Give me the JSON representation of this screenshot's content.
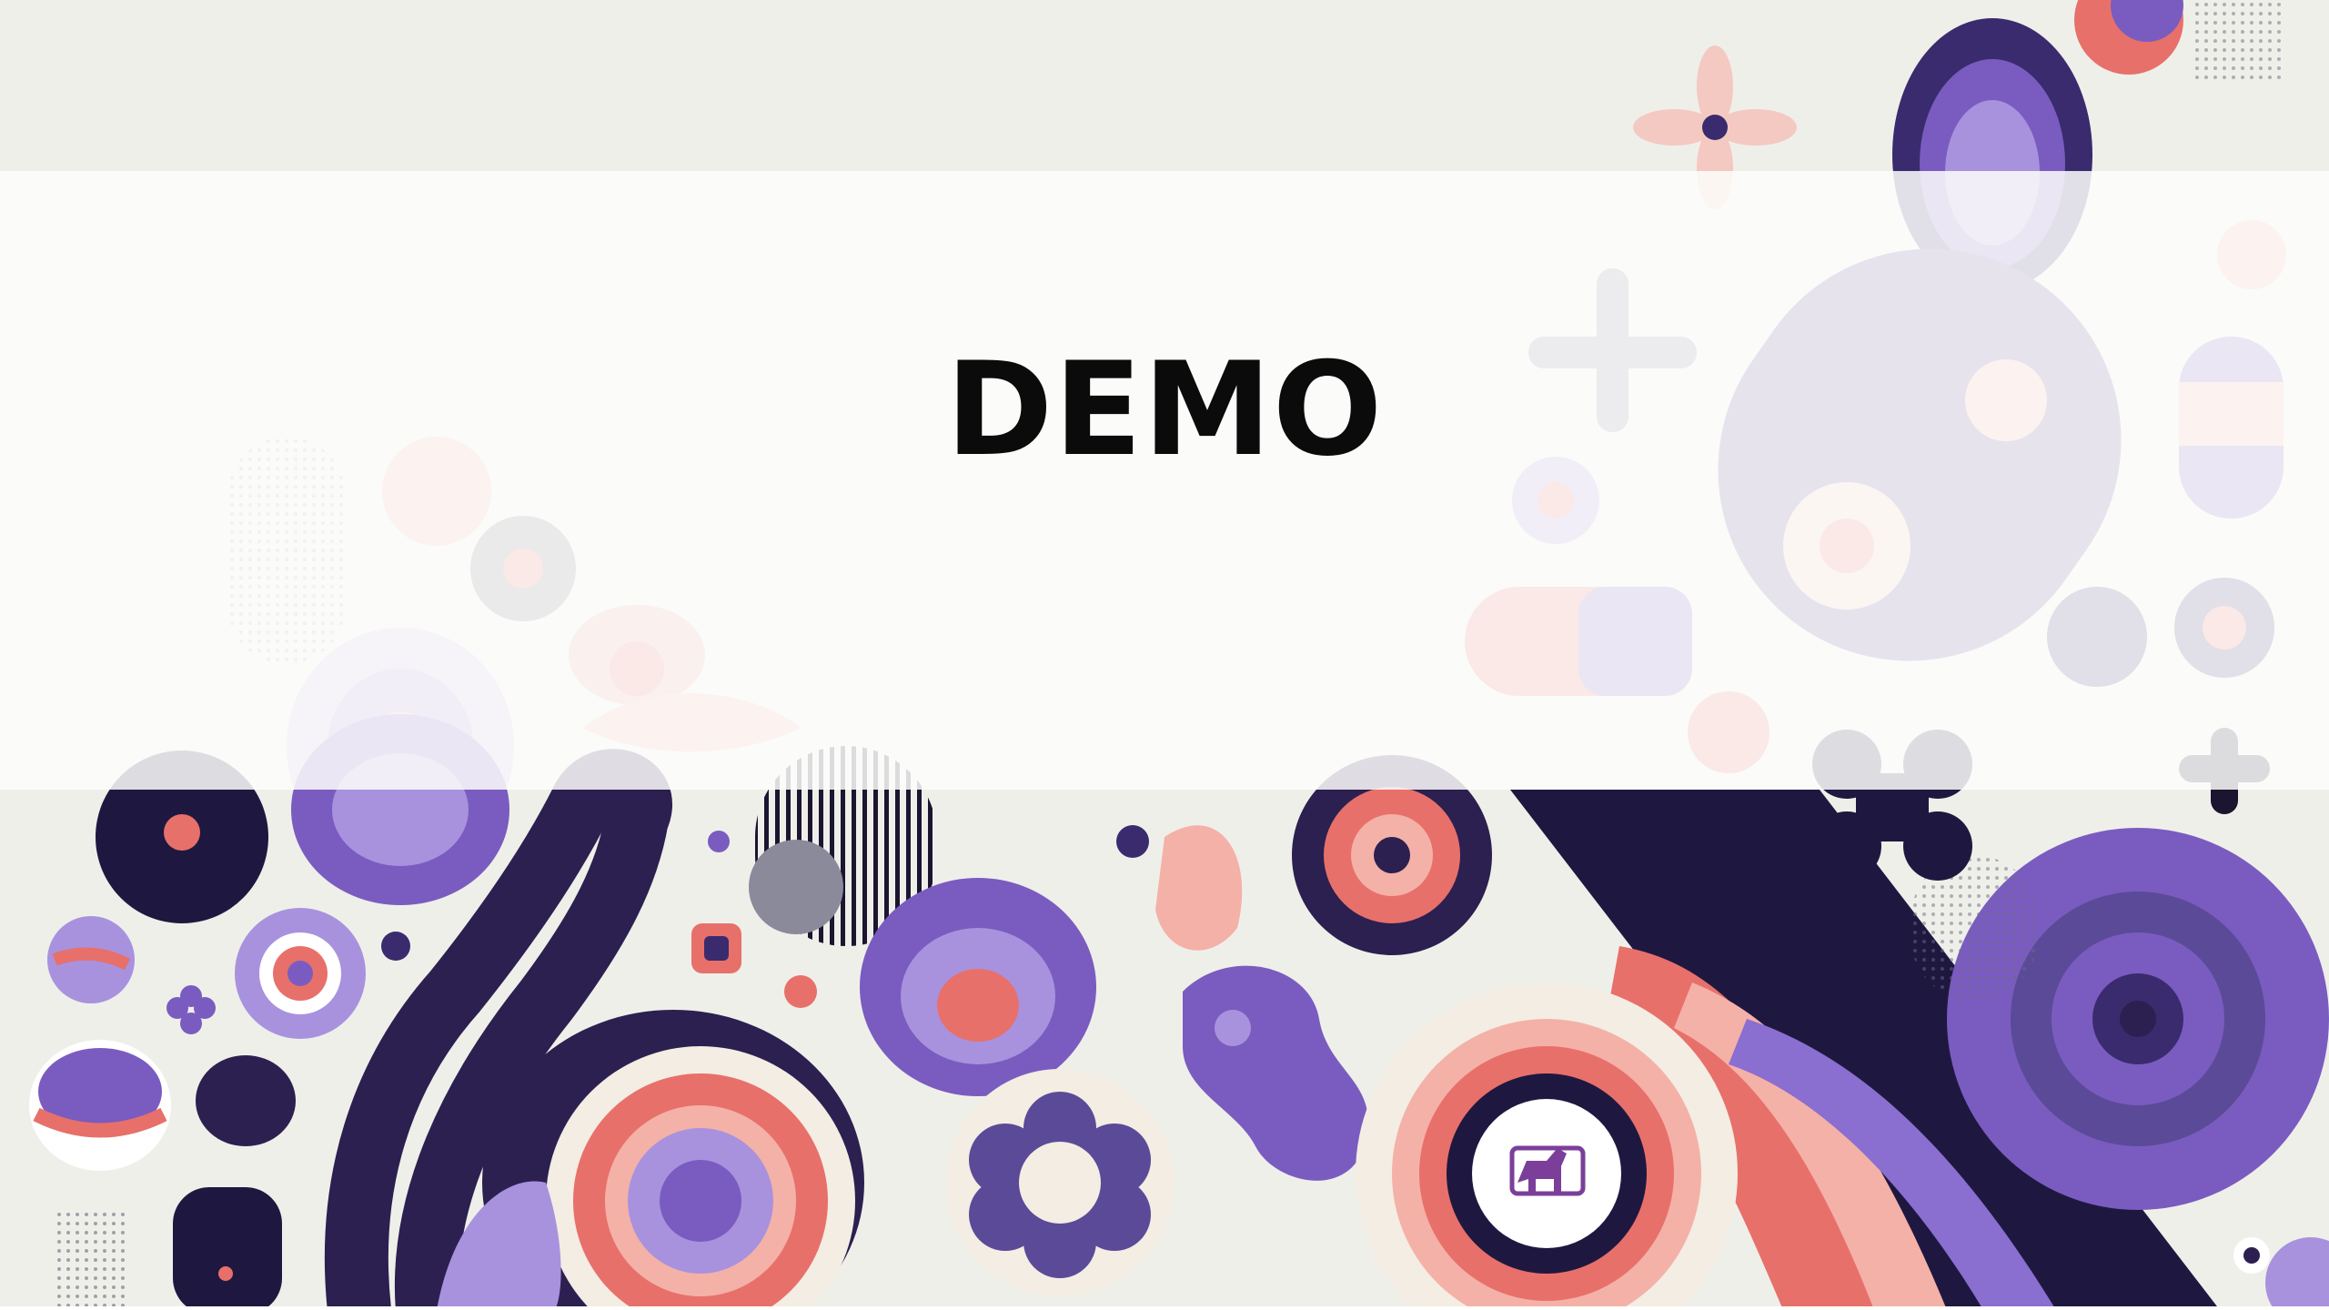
{
  "slide": {
    "title": "DEMO",
    "logo_icon": "dala-horse-presentation-icon"
  },
  "colors": {
    "background": "#efefea",
    "deep_purple": "#2b2050",
    "purple": "#7a5cc0",
    "lavender": "#a892de",
    "coral": "#e8706a",
    "pink": "#f4b1a8",
    "cream": "#f3ede3",
    "title_text": "#0b0b0b"
  }
}
